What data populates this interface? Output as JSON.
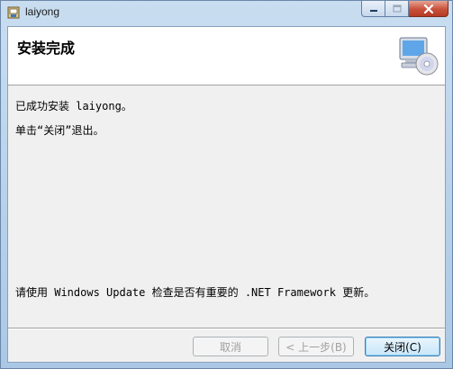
{
  "window": {
    "title": "laiyong",
    "minimize_icon": "minimize-icon",
    "maximize_icon": "maximize-icon",
    "close_icon": "close-icon",
    "app_icon": "installer-app-icon"
  },
  "header": {
    "title": "安装完成",
    "icon": "computer-cd-icon"
  },
  "body": {
    "line1": "已成功安装 laiyong。",
    "line2": "单击“关闭”退出。",
    "line3": "请使用 Windows Update 检查是否有重要的 .NET Framework 更新。"
  },
  "buttons": {
    "cancel": "取消",
    "back": "< 上一步(B)",
    "close": "关闭(C)"
  },
  "colors": {
    "frame": "#aac8e6",
    "header_bg": "#ffffff",
    "client_bg": "#f0f0f0",
    "close_red": "#c8503a",
    "default_btn_border": "#3c7fb1"
  }
}
